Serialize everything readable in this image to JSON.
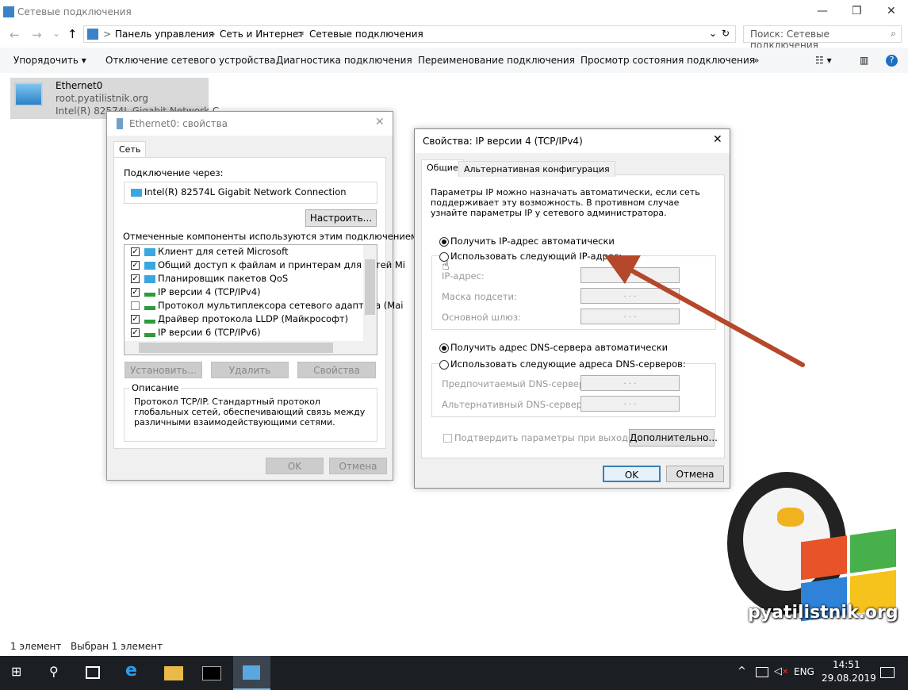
{
  "window": {
    "title": "Сетевые подключения",
    "minimize": "—",
    "maximize": "❐",
    "close": "✕"
  },
  "address": {
    "back": "←",
    "forward": "→",
    "recent": "⌄",
    "up": "↑",
    "breadcrumb": [
      "Панель управления",
      "Сеть и Интернет",
      "Сетевые подключения"
    ],
    "separator": ">",
    "dropdown": "⌄",
    "refresh": "↻",
    "search_placeholder": "Поиск: Сетевые подключения",
    "search_icon": "⌕"
  },
  "toolbar": {
    "items": [
      "Упорядочить ▾",
      "Отключение сетевого устройства",
      "Диагностика подключения",
      "Переименование подключения",
      "Просмотр состояния подключения"
    ],
    "more": "»",
    "view": "☷ ▾",
    "pane": "▥",
    "help": "?"
  },
  "connection": {
    "name": "Ethernet0",
    "domain": "root.pyatilistnik.org",
    "adapter": "Intel(R) 82574L Gigabit Network C..."
  },
  "eth_dialog": {
    "title": "Ethernet0: свойства",
    "close": "✕",
    "tab": "Сеть",
    "connect_via_label": "Подключение через:",
    "adapter": "Intel(R) 82574L Gigabit Network Connection",
    "configure": "Настроить...",
    "components_label": "Отмеченные компоненты используются этим подключением:",
    "components": [
      {
        "label": "Клиент для сетей Microsoft",
        "checked": true,
        "icon": "network"
      },
      {
        "label": "Общий доступ к файлам и принтерам для сетей Mi",
        "checked": true,
        "icon": "network"
      },
      {
        "label": "Планировщик пакетов QoS",
        "checked": true,
        "icon": "network"
      },
      {
        "label": "IP версии 4 (TCP/IPv4)",
        "checked": true,
        "icon": "protocol"
      },
      {
        "label": "Протокол мультиплексора сетевого адаптера (Mai",
        "checked": false,
        "icon": "protocol"
      },
      {
        "label": "Драйвер протокола LLDP (Майкрософт)",
        "checked": true,
        "icon": "protocol"
      },
      {
        "label": "IP версии 6 (TCP/IPv6)",
        "checked": true,
        "icon": "protocol"
      }
    ],
    "install": "Установить...",
    "remove": "Удалить",
    "properties": "Свойства",
    "desc_title": "Описание",
    "description": "Протокол TCP/IP. Стандартный протокол глобальных сетей, обеспечивающий связь между различными взаимодействующими сетями.",
    "ok": "OK",
    "cancel": "Отмена"
  },
  "ipv4_dialog": {
    "title": "Свойства: IP версии 4 (TCP/IPv4)",
    "close": "✕",
    "tabs": [
      "Общие",
      "Альтернативная конфигурация"
    ],
    "intro": "Параметры IP можно назначать автоматически, если сеть поддерживает эту возможность. В противном случае узнайте параметры IP у сетевого администратора.",
    "auto_ip": "Получить IP-адрес автоматически",
    "manual_ip": "Использовать следующий IP-адрес:",
    "ip_label": "IP-адрес:",
    "mask_label": "Маска подсети:",
    "gateway_label": "Основной шлюз:",
    "ip_empty": ".     .     .",
    "auto_dns": "Получить адрес DNS-сервера автоматически",
    "manual_dns": "Использовать следующие адреса DNS-серверов:",
    "dns1_label": "Предпочитаемый DNS-сервер:",
    "dns2_label": "Альтернативный DNS-сервер:",
    "validate": "Подтвердить параметры при выходе",
    "advanced": "Дополнительно...",
    "ok": "OK",
    "cancel": "Отмена",
    "selected": "auto"
  },
  "annotation": {
    "arrow_color": "#b5472b"
  },
  "watermark": {
    "text": "pyatilistnik.org"
  },
  "statusbar": {
    "count": "1 элемент",
    "selected": "Выбран 1 элемент"
  },
  "taskbar": {
    "lang": "ENG",
    "time": "14:51",
    "date": "29.08.2019",
    "chevron": "^",
    "start": "⊞",
    "search": "⚲"
  }
}
